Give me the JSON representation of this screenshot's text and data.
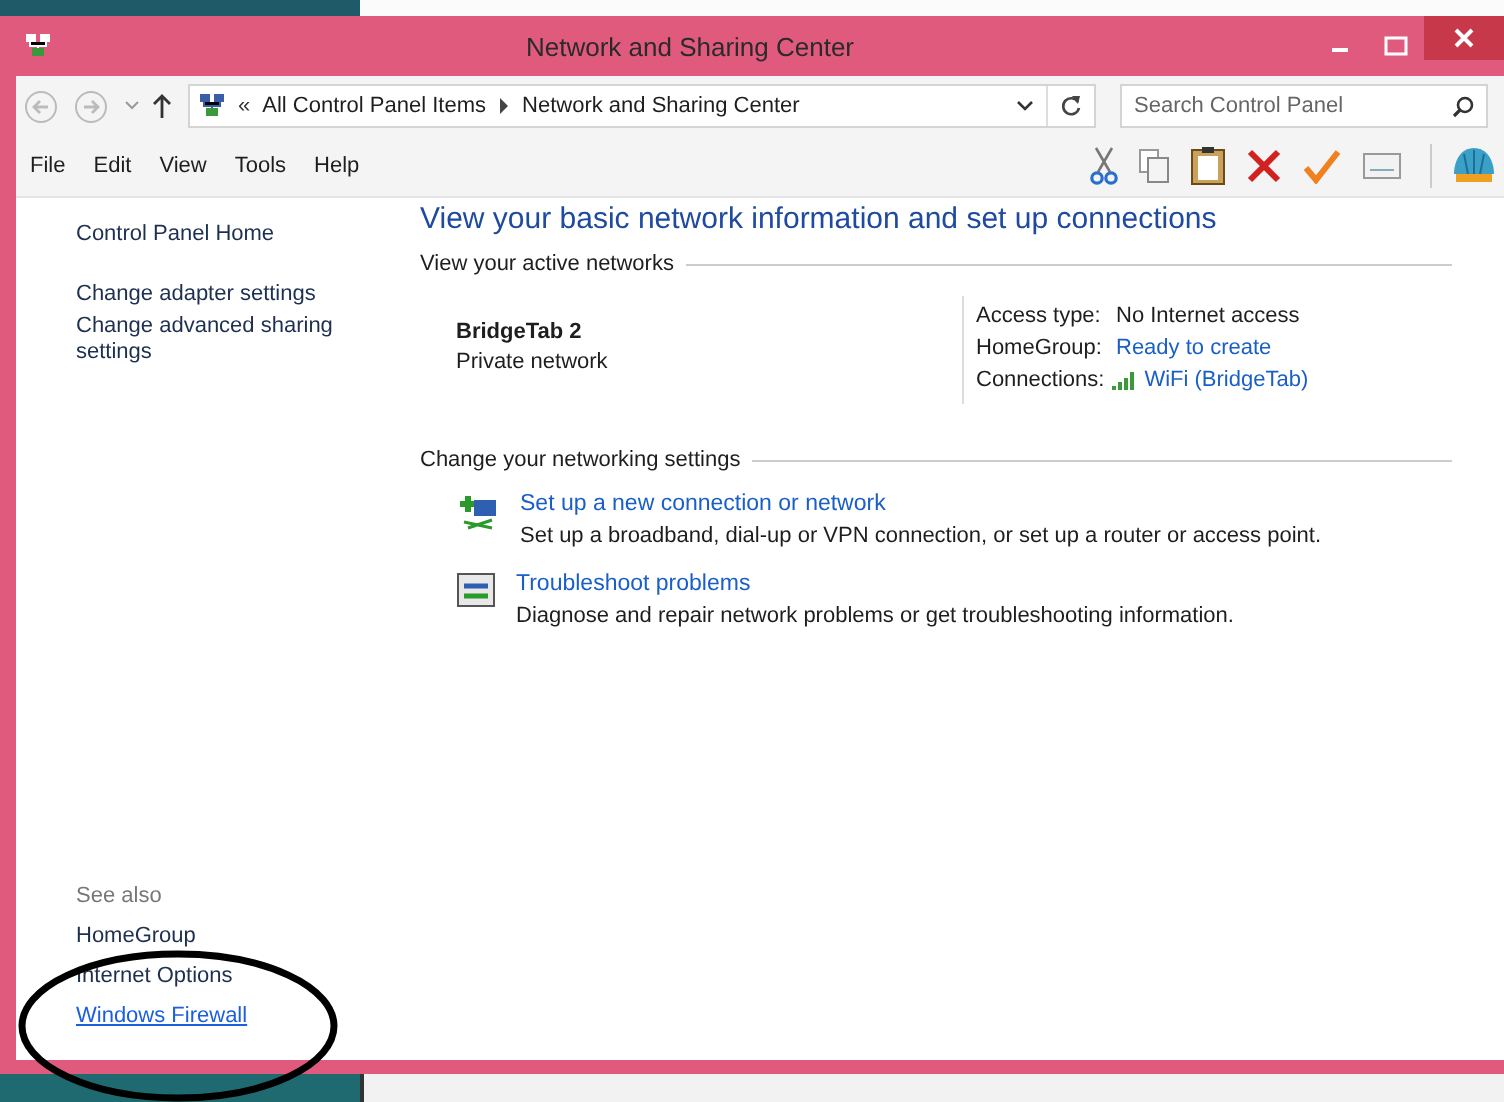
{
  "window": {
    "title": "Network and Sharing Center"
  },
  "address_bar": {
    "prefix": "«",
    "crumbs": [
      "All Control Panel Items",
      "Network and Sharing Center"
    ]
  },
  "search": {
    "placeholder": "Search Control Panel"
  },
  "menu": [
    "File",
    "Edit",
    "View",
    "Tools",
    "Help"
  ],
  "sidebar": {
    "items": [
      {
        "label": "Control Panel Home"
      },
      {
        "label": "Change adapter settings"
      },
      {
        "label": "Change advanced sharing settings"
      }
    ],
    "see_also_title": "See also",
    "see_also": [
      {
        "label": "HomeGroup",
        "hovered": false
      },
      {
        "label": "Internet Options",
        "hovered": false
      },
      {
        "label": "Windows Firewall",
        "hovered": true
      }
    ]
  },
  "main": {
    "heading": "View your basic network information and set up connections",
    "active_networks_label": "View your active networks",
    "network": {
      "name": "BridgeTab  2",
      "type": "Private network"
    },
    "details": [
      {
        "label": "Access type:",
        "value": "No Internet access",
        "kind": "text"
      },
      {
        "label": "HomeGroup:",
        "value": "Ready to create",
        "kind": "link"
      },
      {
        "label": "Connections:",
        "value": "WiFi (BridgeTab)",
        "kind": "signal-link"
      }
    ],
    "change_label": "Change your networking settings",
    "tasks": [
      {
        "kind": "new-connection",
        "title": "Set up a new connection or network",
        "description": "Set up a broadband, dial-up or VPN connection, or set up a router or access point."
      },
      {
        "kind": "troubleshoot",
        "title": "Troubleshoot problems",
        "description": "Diagnose and repair network problems or get troubleshooting information."
      }
    ]
  }
}
